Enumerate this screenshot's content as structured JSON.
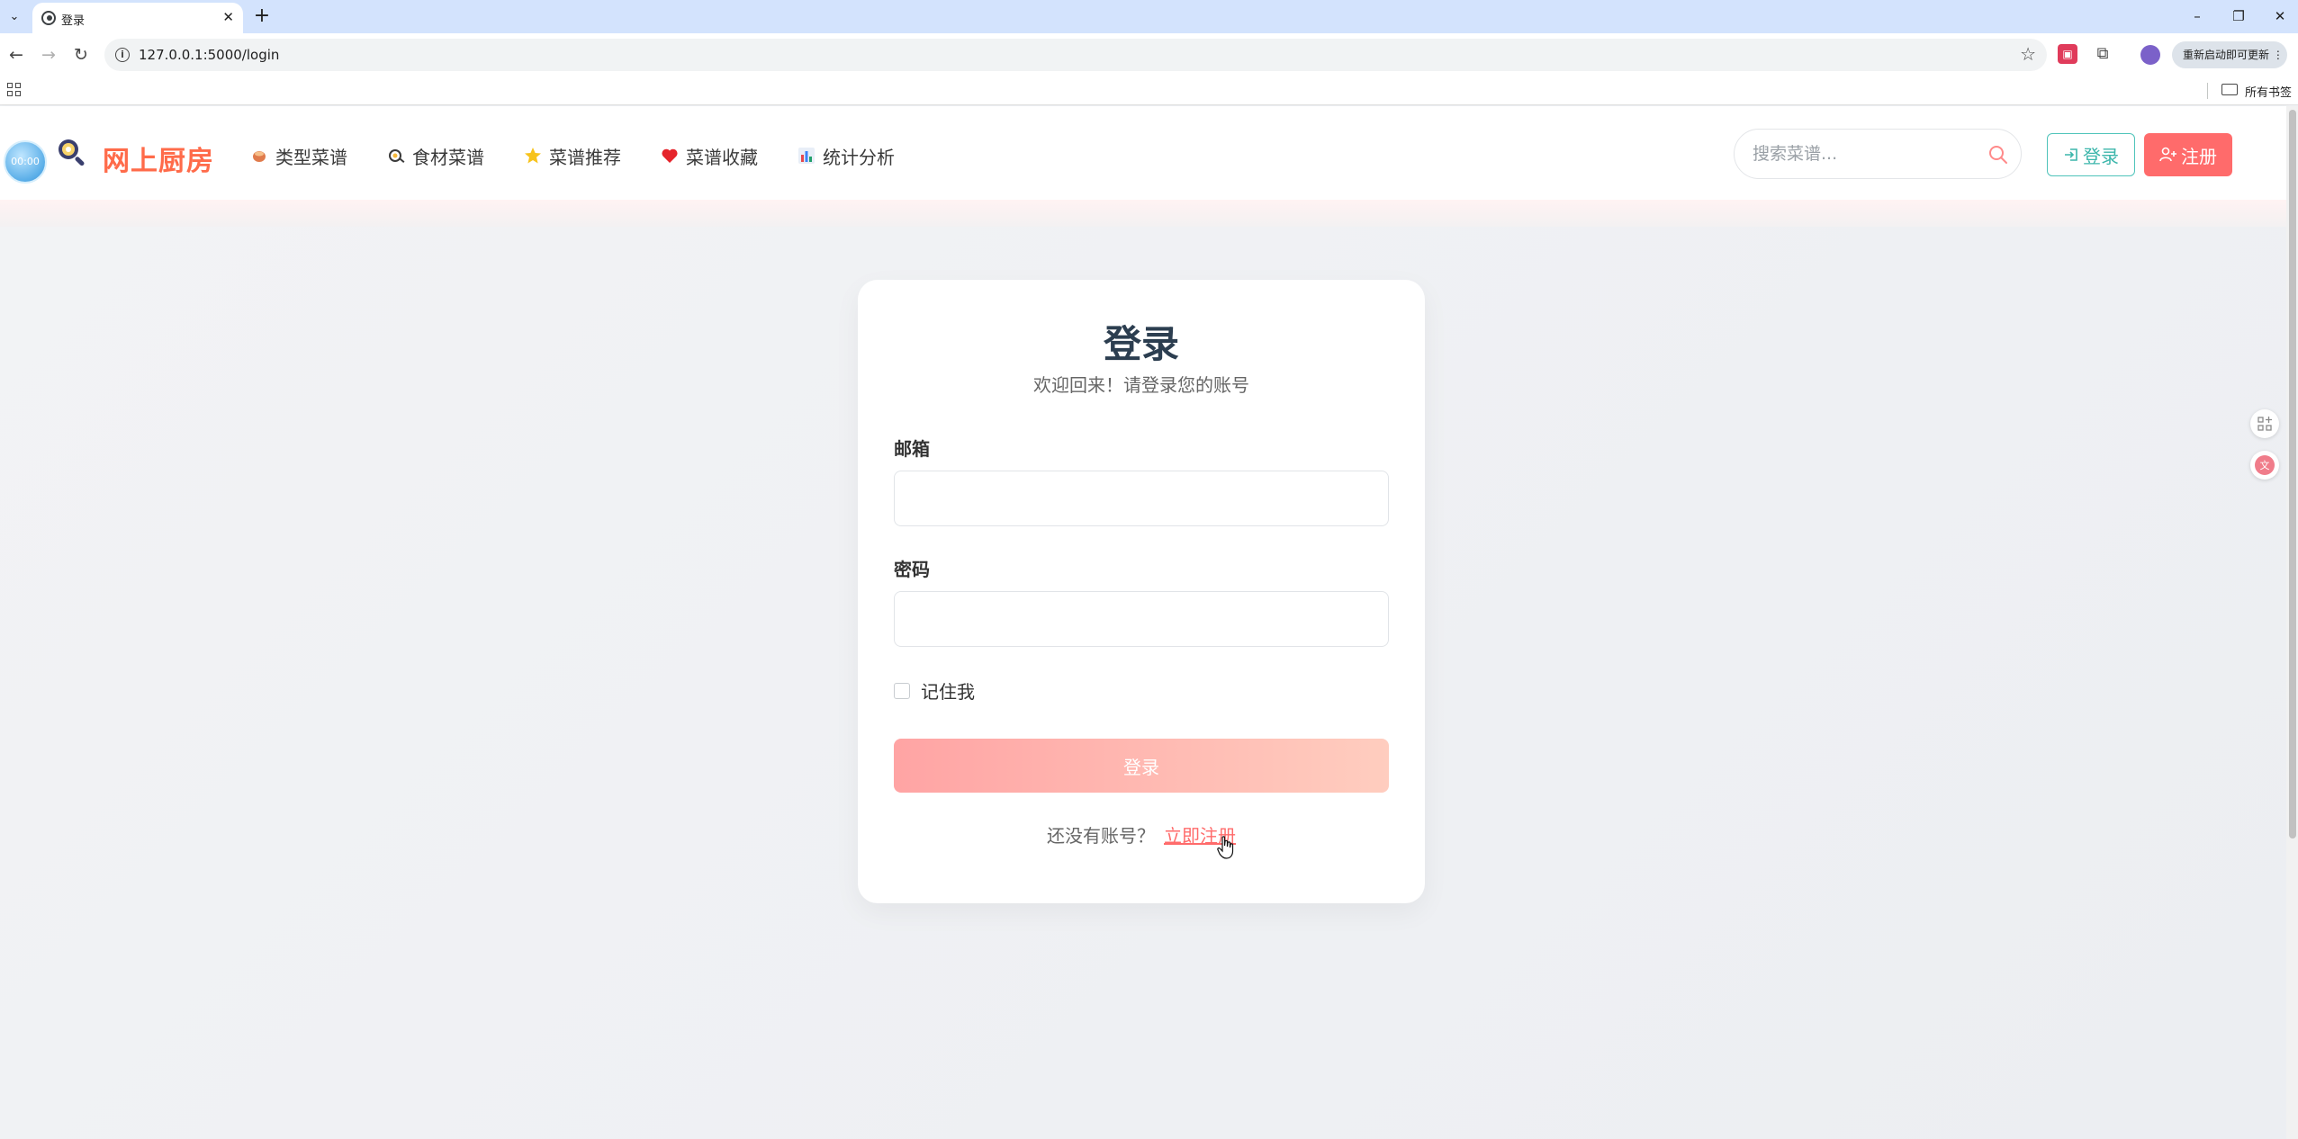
{
  "browser": {
    "tab_title": "登录",
    "url": "127.0.0.1:5000/login",
    "update_button": "重新启动即可更新",
    "bookmarks_all": "所有书签"
  },
  "site": {
    "avatar_text": "00:00",
    "brand": "网上厨房",
    "nav": [
      {
        "label": "类型菜谱",
        "icon": "bowl-icon"
      },
      {
        "label": "食材菜谱",
        "icon": "egg-pan-icon"
      },
      {
        "label": "菜谱推荐",
        "icon": "star-icon"
      },
      {
        "label": "菜谱收藏",
        "icon": "heart-icon"
      },
      {
        "label": "统计分析",
        "icon": "bar-chart-icon"
      }
    ],
    "search_placeholder": "搜索菜谱...",
    "login_button": "登录",
    "register_button": "注册"
  },
  "login_form": {
    "title": "登录",
    "subtitle": "欢迎回来！请登录您的账号",
    "email_label": "邮箱",
    "password_label": "密码",
    "remember_label": "记住我",
    "submit_label": "登录",
    "no_account_text": "还没有账号？",
    "register_link": "立即注册"
  },
  "colors": {
    "brand": "#ff6b4a",
    "accent_teal": "#3cb6ab",
    "accent_red": "#ff6b6b",
    "tabbar": "#d3e3fd"
  }
}
